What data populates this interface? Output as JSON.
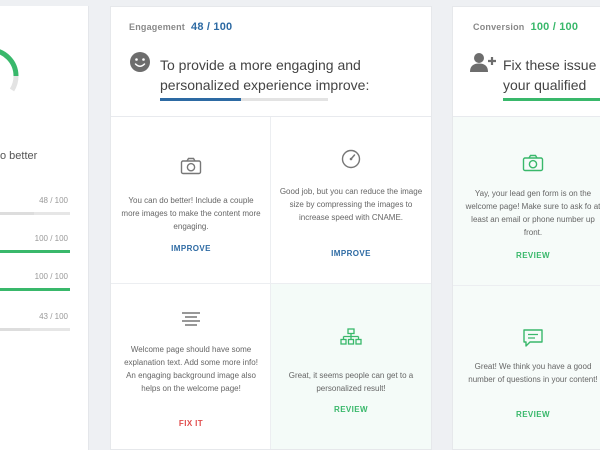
{
  "left_panel": {
    "text": "o better",
    "scores": [
      {
        "value": "48 / 100",
        "fraction": 0.48,
        "color": "#dddddd"
      },
      {
        "value": "100 / 100",
        "fraction": 1.0,
        "color": "#39b86b"
      },
      {
        "value": "100 / 100",
        "fraction": 1.0,
        "color": "#39b86b"
      },
      {
        "value": "43 / 100",
        "fraction": 0.43,
        "color": "#dddddd"
      }
    ]
  },
  "engagement": {
    "label": "Engagement",
    "score": "48 / 100",
    "score_color": "#2d6aa3",
    "title_line1": "To provide a more engaging and",
    "title_line2": "personalized experience improve:",
    "progress": 0.48,
    "progress_color": "#2d6aa3",
    "cards": [
      {
        "icon": "camera-icon",
        "message": "You can do better! Include a couple more images to make the content more engaging.",
        "action": "IMPROVE"
      },
      {
        "icon": "gauge-icon",
        "message": "Good job, but you can reduce the image size by compressing the images to increase speed with CNAME.",
        "action": "IMPROVE"
      },
      {
        "icon": "text-align-icon",
        "message": "Welcome page should have some explanation text. Add some more info! An engaging background image also helps on the welcome page!",
        "action": "FIX IT"
      },
      {
        "icon": "sitemap-icon",
        "message": "Great, it seems people can get to a personalized result!",
        "action": "REVIEW"
      }
    ]
  },
  "conversion": {
    "label": "Conversion",
    "score": "100 / 100",
    "score_color": "#39b86b",
    "title_line1": "Fix these issue",
    "title_line2": "your qualified",
    "progress": 1.0,
    "progress_color": "#39b86b",
    "cards": [
      {
        "icon": "camera-icon",
        "message": "Yay, your lead gen form is on the welcome page! Make sure to ask fo at least an email or phone number up front.",
        "action": "REVIEW"
      },
      {
        "icon": "chat-icon",
        "message": "Great! We think you have a good number of questions in your content!",
        "action": "REVIEW"
      }
    ]
  }
}
